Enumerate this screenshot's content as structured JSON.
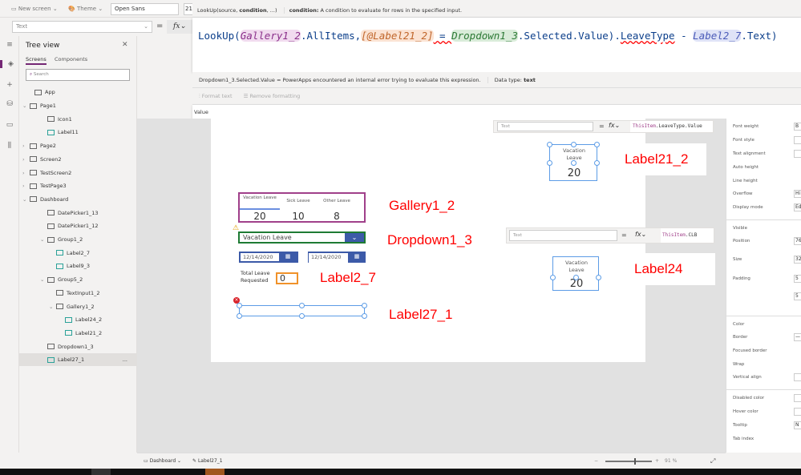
{
  "toolbar": {
    "new_screen": "New screen",
    "theme": "Theme",
    "font": "Open Sans",
    "font_size": "21"
  },
  "tooltip": {
    "signature_prefix": "LookUp(source, ",
    "signature_bold": "condition",
    "signature_suffix": ", ...)",
    "param_name": "condition:",
    "param_desc": "A condition to evaluate for rows in the specified input."
  },
  "property_bar": {
    "property": "Text",
    "equals": "=",
    "fx": "fx"
  },
  "formula": {
    "t1": "LookUp(",
    "t2": "Gallery1_2",
    "t3": ".AllItems,",
    "t4": "[@Label21_2]",
    "t5": " = ",
    "t6": "Dropdown1_3",
    "t7": ".Selected.Value).",
    "t8": "LeaveType",
    "t9": " - ",
    "t10": "Label2_7",
    "t11": ".Text)"
  },
  "result": {
    "expression": "Dropdown1_3.Selected.Value",
    "equals": "=",
    "message": "PowerApps encountered an internal error trying to evaluate this expression.",
    "data_type_label": "Data type:",
    "data_type": "text"
  },
  "format": {
    "format_text": "Format text",
    "remove_formatting": "Remove formatting"
  },
  "value_label": "Value",
  "tree": {
    "title": "Tree view",
    "tabs": [
      "Screens",
      "Components"
    ],
    "search_placeholder": "Search",
    "items": [
      "App",
      "Page1",
      "Icon1",
      "Label11",
      "Page2",
      "Screen2",
      "TestScreen2",
      "TestPage3",
      "Dashboard",
      "DatePicker1_13",
      "DatePicker1_12",
      "Group1_2",
      "Label2_7",
      "Label9_3",
      "Group5_2",
      "TextInput1_2",
      "Gallery1_2",
      "Label24_2",
      "Label21_2",
      "Dropdown1_3",
      "Label27_1"
    ],
    "more": "..."
  },
  "canvas": {
    "gallery": {
      "headers": [
        "Vacation Leave",
        "Sick Leave",
        "Other Leave"
      ],
      "values": [
        "20",
        "10",
        "8"
      ]
    },
    "dropdown_value": "Vacation Leave",
    "dates": [
      "12/14/2020",
      "12/14/2020"
    ],
    "total_label": "Total Leave Requested",
    "total_value": "0",
    "annotations": {
      "gallery": "Gallery1_2",
      "dropdown": "Dropdown1_3",
      "label2_7": "Label2_7",
      "label27_1": "Label27_1",
      "label21_2": "Label21_2",
      "label24": "Label24"
    },
    "popup1": {
      "property": "Text",
      "formula_a": "ThisItem",
      "formula_b": ".LeaveType.Value"
    },
    "popup2": {
      "property": "Text",
      "formula_a": "ThisItem",
      "formula_b": ".CLB"
    },
    "label21_header": "Vacation Leave",
    "label21_value": "20",
    "label24_header": "Vacation Leave",
    "label24_value": "20"
  },
  "props": {
    "rows": [
      {
        "label": "Font weight",
        "value": "B"
      },
      {
        "label": "Font style",
        "value": ""
      },
      {
        "label": "Text alignment",
        "value": ""
      },
      {
        "label": "Auto height",
        "value": ""
      },
      {
        "label": "Line height",
        "value": ""
      },
      {
        "label": "Overflow",
        "value": "Hi"
      },
      {
        "label": "Display mode",
        "value": "Ed"
      },
      {
        "label": "Visible",
        "value": ""
      },
      {
        "label": "Position",
        "value": "76"
      },
      {
        "label": "Size",
        "value": "32"
      },
      {
        "label": "Padding",
        "value": "5"
      },
      {
        "label": "",
        "value": "5"
      },
      {
        "label": "Color",
        "value": ""
      },
      {
        "label": "Border",
        "value": "—"
      },
      {
        "label": "Focused border",
        "value": ""
      },
      {
        "label": "Wrap",
        "value": ""
      },
      {
        "label": "Vertical align",
        "value": ""
      },
      {
        "label": "Disabled color",
        "value": ""
      },
      {
        "label": "Hover color",
        "value": ""
      },
      {
        "label": "Tooltip",
        "value": "N"
      },
      {
        "label": "Tab index",
        "value": ""
      }
    ]
  },
  "status": {
    "screen": "Dashboard",
    "control": "Label27_1",
    "zoom": "91",
    "zoom_unit": "%",
    "minus": "−",
    "plus": "+"
  },
  "colors": {
    "accent": "#742774",
    "error_red": "#ff0000",
    "gallery_border": "#a0408a",
    "dropdown_border": "#1e7b34",
    "input_border": "#f0922a",
    "blue": "#3c5aa8"
  }
}
